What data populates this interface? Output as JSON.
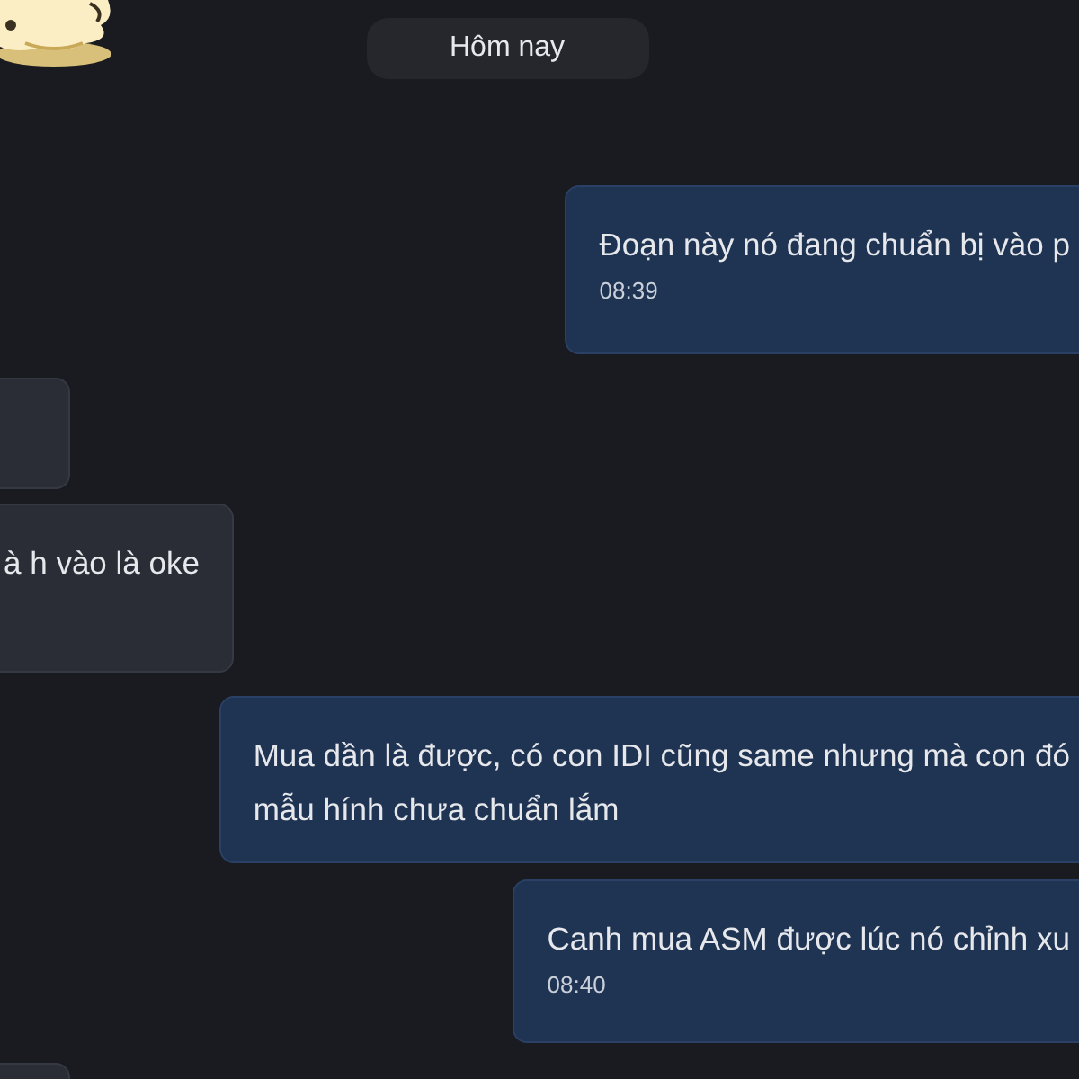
{
  "date_separator": "Hôm nay",
  "messages": [
    {
      "kind": "outgoing",
      "lines": [
        "Đoạn này nó đang chuẩn bị vào p"
      ],
      "time": "08:39"
    },
    {
      "kind": "incoming"
    },
    {
      "kind": "incoming",
      "lines": [
        "à h vào là oke"
      ]
    },
    {
      "kind": "outgoing",
      "lines": [
        "Mua dần là được, có con IDI cũng same nhưng mà con đó",
        "mẫu hính chưa chuẩn lắm"
      ]
    },
    {
      "kind": "outgoing",
      "lines": [
        "Canh mua ASM được lúc nó chỉnh xu"
      ],
      "time": "08:40"
    },
    {
      "kind": "incoming"
    }
  ]
}
